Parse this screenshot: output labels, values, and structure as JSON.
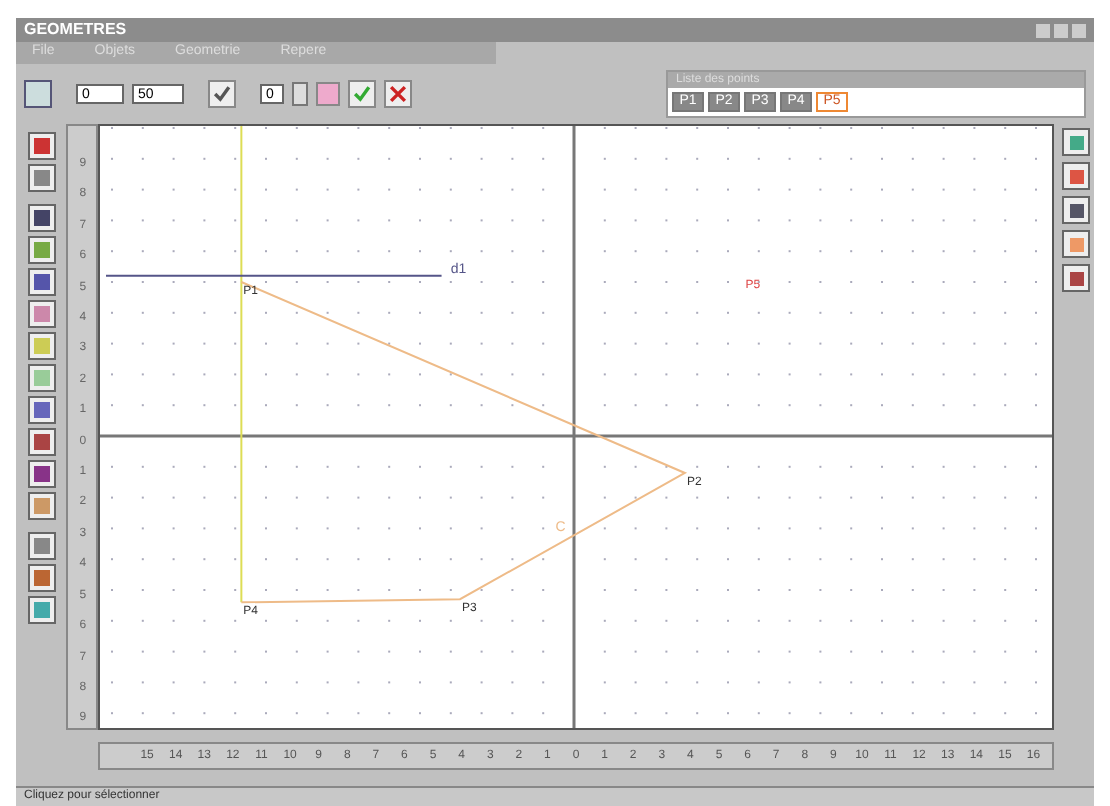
{
  "window": {
    "title": "GEOMETRES"
  },
  "menu": [
    "File",
    "Objets",
    "Geometrie",
    "Repere"
  ],
  "toolbar": {
    "field_1": "0",
    "field_2": "50",
    "spin_value": "0"
  },
  "points_panel": {
    "title": "Liste des points",
    "items": [
      {
        "label": "P1",
        "selected": false
      },
      {
        "label": "P2",
        "selected": false
      },
      {
        "label": "P3",
        "selected": false
      },
      {
        "label": "P4",
        "selected": false
      },
      {
        "label": "P5",
        "selected": true
      }
    ]
  },
  "canvas": {
    "point_labels": [
      "P1",
      "P2",
      "P3",
      "P4",
      "P5"
    ],
    "line_label": "d1",
    "segment_label": "C"
  },
  "x_ruler": [
    "15",
    "14",
    "13",
    "12",
    "11",
    "10",
    "9",
    "8",
    "7",
    "6",
    "5",
    "4",
    "3",
    "2",
    "1",
    "0",
    "1",
    "2",
    "3",
    "4",
    "5",
    "6",
    "7",
    "8",
    "9",
    "10",
    "11",
    "12",
    "13",
    "14",
    "15",
    "16"
  ],
  "y_ruler": [
    "9",
    "8",
    "7",
    "6",
    "5",
    "4",
    "3",
    "2",
    "1",
    "0",
    "1",
    "2",
    "3",
    "4",
    "5",
    "6",
    "7",
    "8",
    "9"
  ],
  "status_bar": "Cliquez pour sélectionner"
}
